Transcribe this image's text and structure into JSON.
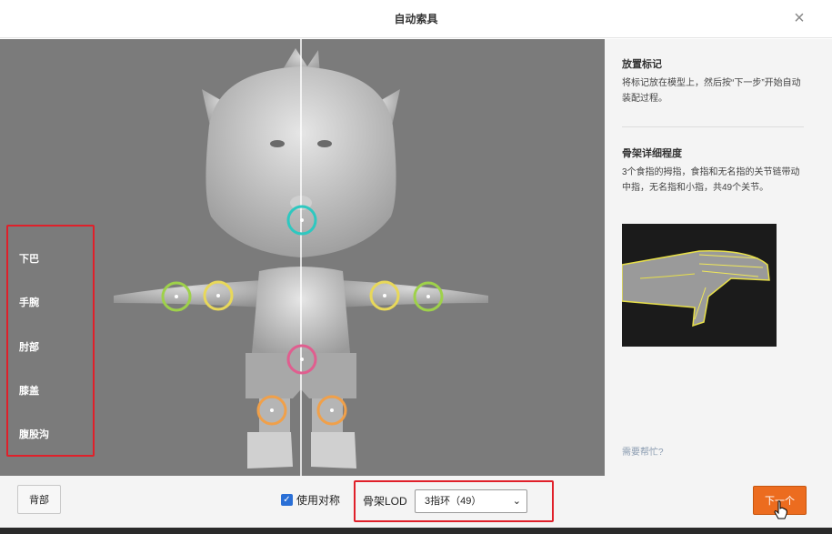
{
  "dialog": {
    "title": "自动索具",
    "close_glyph": "×"
  },
  "markers": {
    "items": [
      {
        "label": "下巴"
      },
      {
        "label": "手腕"
      },
      {
        "label": "肘部"
      },
      {
        "label": "膝盖"
      },
      {
        "label": "腹股沟"
      }
    ],
    "colors": {
      "chin": "#2ec8c0",
      "wrist": "#9ed14a",
      "elbow": "#e8d85a",
      "groin": "#e05e8f",
      "knee": "#f0a04a",
      "highlight": "#e0202a"
    }
  },
  "side": {
    "place_title": "放置标记",
    "place_text": "将标记放在模型上，然后按“下一步”开始自动装配过程。",
    "detail_title": "骨架详细程度",
    "detail_text": "3个食指的拇指，食指和无名指的关节链带动中指，无名指和小指，共49个关节。",
    "help": "需要帮忙?"
  },
  "footer": {
    "back": "背部",
    "symmetry_label": "使用对称",
    "symmetry_checked": true,
    "lod_label": "骨架LOD",
    "lod_value": "3指环（49）",
    "next": "下一个"
  }
}
